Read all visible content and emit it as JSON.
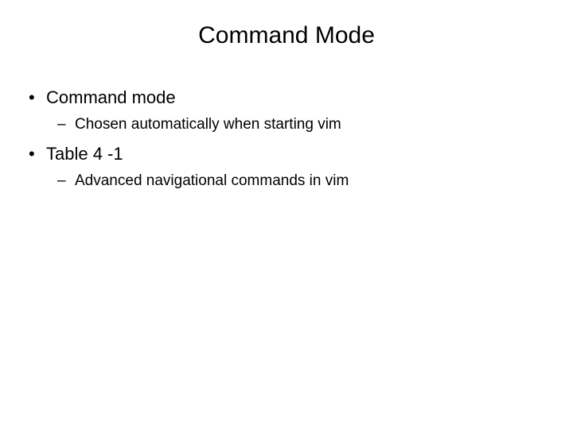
{
  "title": "Command Mode",
  "bullets": [
    {
      "text": "Command mode",
      "sub": [
        {
          "text": "Chosen automatically when starting vim"
        }
      ]
    },
    {
      "text": "Table 4 -1",
      "sub": [
        {
          "text": "Advanced navigational commands in vim"
        }
      ]
    }
  ]
}
